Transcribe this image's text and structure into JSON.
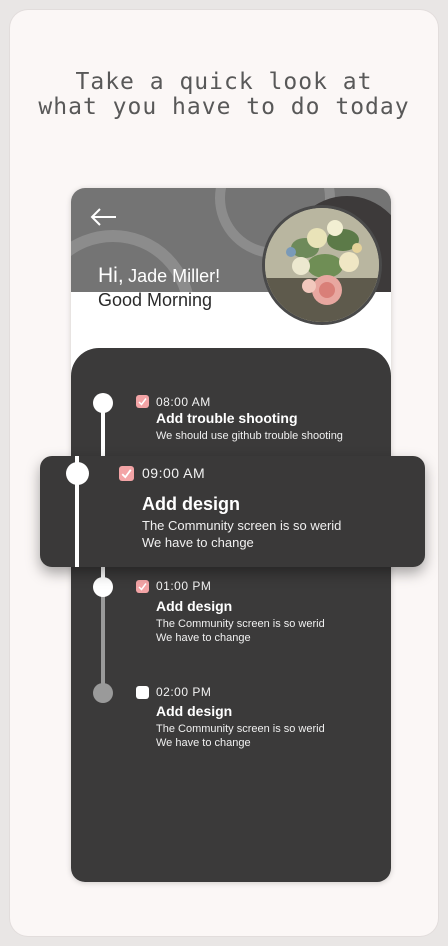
{
  "headline": {
    "line1": "Take a quick look at",
    "line2": "what you have to do today"
  },
  "header": {
    "back_icon": "arrow-left-icon",
    "hi": "Hi,",
    "name": "Jade Miller!",
    "greeting": "Good Morning",
    "avatar": "flower-bouquet-painting"
  },
  "colors": {
    "panel": "#3b3a3a",
    "accent_check": "#f3a4a6",
    "header_bg": "#747474",
    "card_bg": "#fbf7f6"
  },
  "tasks": [
    {
      "time": "08:00 AM",
      "title": "Add trouble shooting",
      "desc1": "We should use github trouble shooting",
      "desc2": "",
      "done": true
    },
    {
      "time": "09:00 AM",
      "title": "Add design",
      "desc1": "The Community screen is so werid",
      "desc2": "We have to change",
      "done": true,
      "highlighted": true
    },
    {
      "time": "01:00 PM",
      "title": "Add design",
      "desc1": "The Community screen is so werid",
      "desc2": "We have to change",
      "done": true
    },
    {
      "time": "02:00 PM",
      "title": "Add design",
      "desc1": "The Community screen is so werid",
      "desc2": "We have to change",
      "done": false
    }
  ]
}
